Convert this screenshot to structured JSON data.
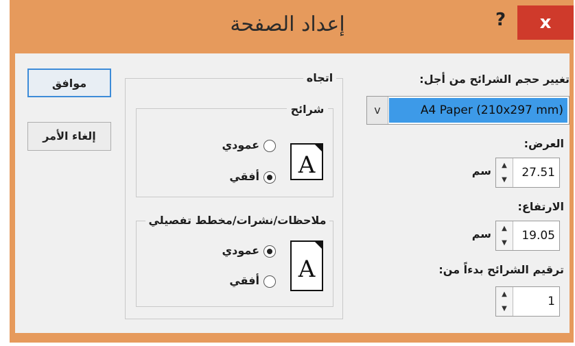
{
  "dialog": {
    "title": "إعداد الصفحة",
    "help": "?",
    "close": "x"
  },
  "buttons": {
    "ok": "موافق",
    "cancel": "إلغاء الأمر"
  },
  "slide_size": {
    "label": "تغيير حجم الشرائح من أجل:",
    "value": "A4 Paper (210x297 mm)",
    "dropdown_arrow": "v"
  },
  "width": {
    "label": "العرض:",
    "value": "27.51",
    "unit": "سم"
  },
  "height": {
    "label": "الارتفاع:",
    "value": "19.05",
    "unit": "سم"
  },
  "numbering": {
    "label": "ترقيم الشرائح بدءاً من:",
    "value": "1"
  },
  "orientation": {
    "label": "اتجاه",
    "slides": {
      "label": "شرائح",
      "portrait": "عمودي",
      "landscape": "أفقي",
      "selected": "landscape"
    },
    "notes": {
      "label": "ملاحظات/نشرات/مخطط تفصيلي",
      "portrait": "عمودي",
      "landscape": "أفقي",
      "selected": "portrait"
    }
  },
  "icons": {
    "page_letter": "A"
  }
}
